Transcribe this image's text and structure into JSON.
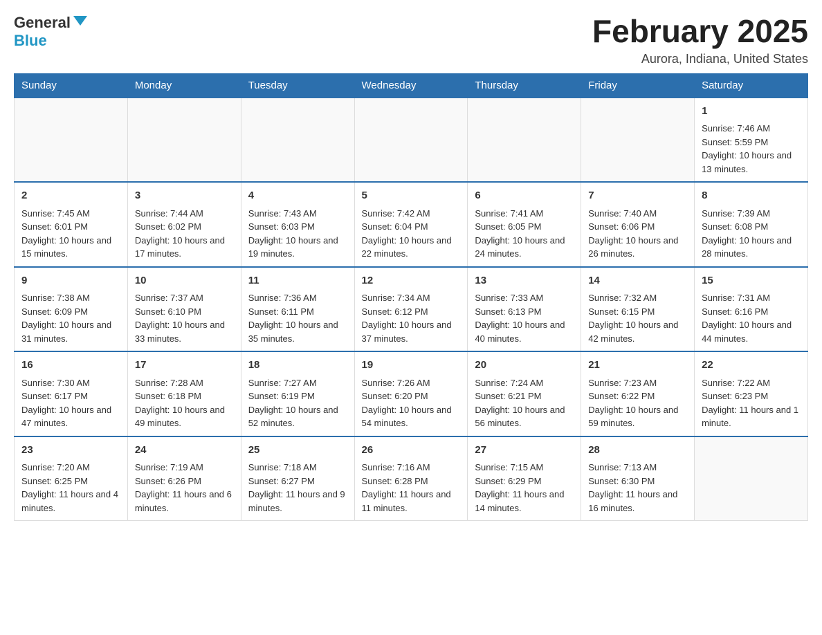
{
  "logo": {
    "general": "General",
    "blue": "Blue"
  },
  "title": {
    "month_year": "February 2025",
    "location": "Aurora, Indiana, United States"
  },
  "days_of_week": [
    "Sunday",
    "Monday",
    "Tuesday",
    "Wednesday",
    "Thursday",
    "Friday",
    "Saturday"
  ],
  "weeks": [
    [
      {
        "day": "",
        "info": ""
      },
      {
        "day": "",
        "info": ""
      },
      {
        "day": "",
        "info": ""
      },
      {
        "day": "",
        "info": ""
      },
      {
        "day": "",
        "info": ""
      },
      {
        "day": "",
        "info": ""
      },
      {
        "day": "1",
        "info": "Sunrise: 7:46 AM\nSunset: 5:59 PM\nDaylight: 10 hours and 13 minutes."
      }
    ],
    [
      {
        "day": "2",
        "info": "Sunrise: 7:45 AM\nSunset: 6:01 PM\nDaylight: 10 hours and 15 minutes."
      },
      {
        "day": "3",
        "info": "Sunrise: 7:44 AM\nSunset: 6:02 PM\nDaylight: 10 hours and 17 minutes."
      },
      {
        "day": "4",
        "info": "Sunrise: 7:43 AM\nSunset: 6:03 PM\nDaylight: 10 hours and 19 minutes."
      },
      {
        "day": "5",
        "info": "Sunrise: 7:42 AM\nSunset: 6:04 PM\nDaylight: 10 hours and 22 minutes."
      },
      {
        "day": "6",
        "info": "Sunrise: 7:41 AM\nSunset: 6:05 PM\nDaylight: 10 hours and 24 minutes."
      },
      {
        "day": "7",
        "info": "Sunrise: 7:40 AM\nSunset: 6:06 PM\nDaylight: 10 hours and 26 minutes."
      },
      {
        "day": "8",
        "info": "Sunrise: 7:39 AM\nSunset: 6:08 PM\nDaylight: 10 hours and 28 minutes."
      }
    ],
    [
      {
        "day": "9",
        "info": "Sunrise: 7:38 AM\nSunset: 6:09 PM\nDaylight: 10 hours and 31 minutes."
      },
      {
        "day": "10",
        "info": "Sunrise: 7:37 AM\nSunset: 6:10 PM\nDaylight: 10 hours and 33 minutes."
      },
      {
        "day": "11",
        "info": "Sunrise: 7:36 AM\nSunset: 6:11 PM\nDaylight: 10 hours and 35 minutes."
      },
      {
        "day": "12",
        "info": "Sunrise: 7:34 AM\nSunset: 6:12 PM\nDaylight: 10 hours and 37 minutes."
      },
      {
        "day": "13",
        "info": "Sunrise: 7:33 AM\nSunset: 6:13 PM\nDaylight: 10 hours and 40 minutes."
      },
      {
        "day": "14",
        "info": "Sunrise: 7:32 AM\nSunset: 6:15 PM\nDaylight: 10 hours and 42 minutes."
      },
      {
        "day": "15",
        "info": "Sunrise: 7:31 AM\nSunset: 6:16 PM\nDaylight: 10 hours and 44 minutes."
      }
    ],
    [
      {
        "day": "16",
        "info": "Sunrise: 7:30 AM\nSunset: 6:17 PM\nDaylight: 10 hours and 47 minutes."
      },
      {
        "day": "17",
        "info": "Sunrise: 7:28 AM\nSunset: 6:18 PM\nDaylight: 10 hours and 49 minutes."
      },
      {
        "day": "18",
        "info": "Sunrise: 7:27 AM\nSunset: 6:19 PM\nDaylight: 10 hours and 52 minutes."
      },
      {
        "day": "19",
        "info": "Sunrise: 7:26 AM\nSunset: 6:20 PM\nDaylight: 10 hours and 54 minutes."
      },
      {
        "day": "20",
        "info": "Sunrise: 7:24 AM\nSunset: 6:21 PM\nDaylight: 10 hours and 56 minutes."
      },
      {
        "day": "21",
        "info": "Sunrise: 7:23 AM\nSunset: 6:22 PM\nDaylight: 10 hours and 59 minutes."
      },
      {
        "day": "22",
        "info": "Sunrise: 7:22 AM\nSunset: 6:23 PM\nDaylight: 11 hours and 1 minute."
      }
    ],
    [
      {
        "day": "23",
        "info": "Sunrise: 7:20 AM\nSunset: 6:25 PM\nDaylight: 11 hours and 4 minutes."
      },
      {
        "day": "24",
        "info": "Sunrise: 7:19 AM\nSunset: 6:26 PM\nDaylight: 11 hours and 6 minutes."
      },
      {
        "day": "25",
        "info": "Sunrise: 7:18 AM\nSunset: 6:27 PM\nDaylight: 11 hours and 9 minutes."
      },
      {
        "day": "26",
        "info": "Sunrise: 7:16 AM\nSunset: 6:28 PM\nDaylight: 11 hours and 11 minutes."
      },
      {
        "day": "27",
        "info": "Sunrise: 7:15 AM\nSunset: 6:29 PM\nDaylight: 11 hours and 14 minutes."
      },
      {
        "day": "28",
        "info": "Sunrise: 7:13 AM\nSunset: 6:30 PM\nDaylight: 11 hours and 16 minutes."
      },
      {
        "day": "",
        "info": ""
      }
    ]
  ]
}
